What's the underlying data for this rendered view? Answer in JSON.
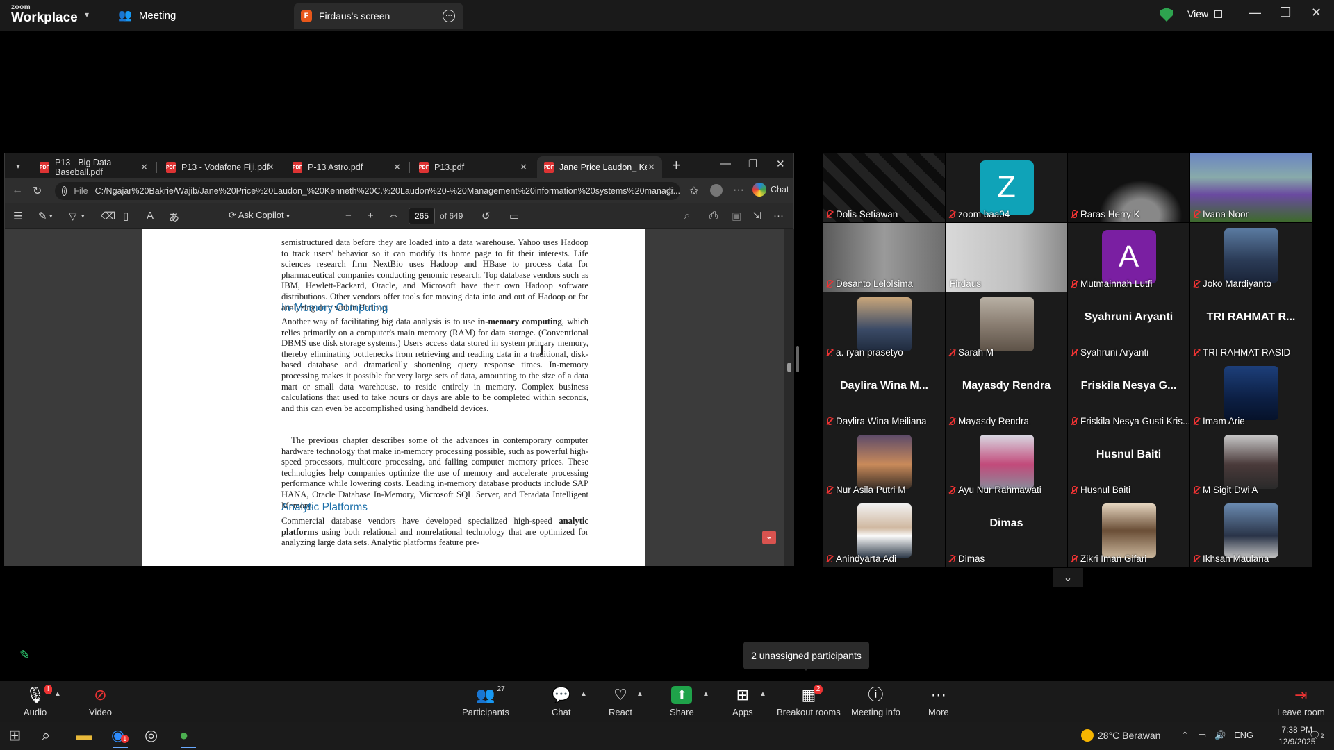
{
  "zoom": {
    "logo_small": "zoom",
    "logo_big": "Workplace",
    "meeting_tab": "Meeting",
    "screen_tab": "Firdaus's screen",
    "screen_tab_initial": "F",
    "view_label": "View"
  },
  "edge": {
    "tabs": [
      {
        "label": "P13 - Big Data Baseball.pdf"
      },
      {
        "label": "P13 - Vodafone Fiji.pdf"
      },
      {
        "label": "P-13 Astro.pdf"
      },
      {
        "label": "P13.pdf"
      },
      {
        "label": "Jane Price Laudon_ Kenneth"
      }
    ],
    "url_scheme": "File",
    "url": "C:/Ngajar%20Bakrie/Wajib/Jane%20Price%20Laudon_%20Kenneth%20C.%20Laudon%20-%20Management%20information%20systems%20managi...",
    "chat_label": "Chat",
    "ask_copilot": "Ask Copilot",
    "page_current": "265",
    "page_total": "of 649"
  },
  "document": {
    "para1": "semistructured data before they are loaded into a data warehouse. Yahoo uses Hadoop to track users' behavior so it can modify its home page to fit their interests. Life sciences research firm NextBio uses Hadoop and HBase to process data for pharmaceutical companies conducting genomic research. Top database vendors such as IBM, Hewlett-Packard, Oracle, and Microsoft have their own Hadoop software distributions. Other vendors offer tools for moving data into and out of Hadoop or for analyzing data within Hadoop.",
    "heading1": "In-Memory Computing",
    "para2_a": "Another way of facilitating big data analysis is to use ",
    "para2_bold": "in-memory computing",
    "para2_b": ", which relies primarily on a computer's main memory (RAM) for data storage. (Conventional DBMS use disk storage systems.) Users access data stored in system primary memory, thereby eliminating bottlenecks from retrieving and reading data in a traditional, disk-based database and dramatically shortening query response times. In-memory processing makes it possible for very large sets of data, amounting to the size of a data mart or small data warehouse, to reside entirely in memory. Complex business calculations that used to take hours or days are able to be completed within seconds, and this can even be accomplished using handheld devices.",
    "para3": "The previous chapter describes some of the advances in contemporary computer hardware technology that make in-memory processing possible, such as powerful high-speed processors, multicore processing, and falling computer memory prices. These technologies help companies optimize the use of memory and accelerate processing performance while lowering costs. Leading in-memory database products include SAP HANA, Oracle Database In-Memory, Microsoft SQL Server, and Teradata Intelligent Memory.",
    "heading2": "Analytic Platforms",
    "para4_a": "Commercial database vendors have developed specialized high-speed ",
    "para4_bold": "analytic platforms",
    "para4_b": " using both relational and nonrelational technology that are optimized for analyzing large data sets. Analytic platforms feature pre-"
  },
  "participants": [
    {
      "name": "Dolis Setiawan"
    },
    {
      "name": "zoom baa04",
      "initial": "Z"
    },
    {
      "name": "Raras Herry K"
    },
    {
      "name": "Ivana Noor"
    },
    {
      "name": "Desanto Lelolsima"
    },
    {
      "name": "Firdaus"
    },
    {
      "name": "Mutmainnah Lutfi",
      "initial": "A"
    },
    {
      "name": "Joko Mardiyanto"
    },
    {
      "name": "a. ryan prasetyo"
    },
    {
      "name": "Sarah M"
    },
    {
      "name": "Syahruni Aryanti",
      "display": "Syahruni Aryanti"
    },
    {
      "name": "TRI RAHMAT RASID",
      "display": "TRI RAHMAT R..."
    },
    {
      "name": "Daylira Wina Meiliana",
      "display": "Daylira Wina M..."
    },
    {
      "name": "Mayasdy Rendra",
      "display": "Mayasdy Rendra"
    },
    {
      "name": "Friskila Nesya Gusti Kris...",
      "display": "Friskila Nesya G..."
    },
    {
      "name": "Imam Arie"
    },
    {
      "name": "Nur Asila Putri M"
    },
    {
      "name": "Ayu Nur Rahmawati"
    },
    {
      "name": "Husnul Baiti",
      "display": "Husnul Baiti"
    },
    {
      "name": "M Sigit Dwi A"
    },
    {
      "name": "Anindyarta Adi"
    },
    {
      "name": "Dimas",
      "display": "Dimas"
    },
    {
      "name": "Zikri Iman Gifari"
    },
    {
      "name": "Ikhsan Maulana"
    }
  ],
  "unassigned_tip": "2 unassigned participants",
  "controls": {
    "audio": "Audio",
    "video": "Video",
    "participants": "Participants",
    "participants_count": "27",
    "chat": "Chat",
    "react": "React",
    "share": "Share",
    "apps": "Apps",
    "breakout": "Breakout rooms",
    "breakout_badge": "2",
    "meeting_info": "Meeting info",
    "more": "More",
    "leave": "Leave room",
    "audio_badge": "!"
  },
  "taskbar": {
    "weather": "28°C Berawan",
    "lang": "ENG",
    "time": "7:38 PM",
    "date": "12/9/2025",
    "notif_count": "2",
    "zoom_badge": "1"
  },
  "colors": {
    "zoom_green": "#2ed273",
    "share_green": "#1fa34a",
    "heading_blue": "#1a6ea8",
    "mute_red": "#e33333"
  }
}
